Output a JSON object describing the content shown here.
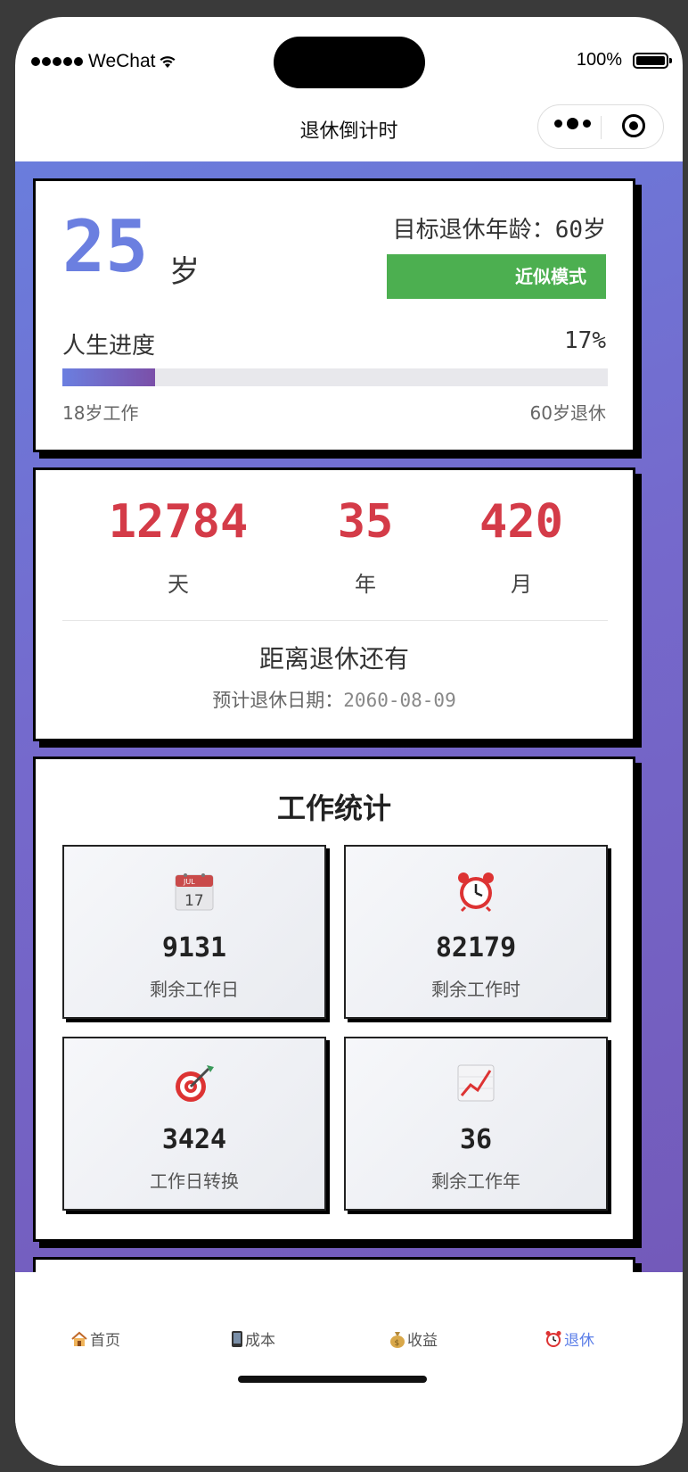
{
  "status_bar": {
    "carrier": "WeChat",
    "battery": "100%"
  },
  "nav": {
    "title": "退休倒计时"
  },
  "age_card": {
    "age": "25",
    "age_unit": "岁",
    "target_label": "目标退休年龄：",
    "target_value": "60岁",
    "mode_button": "近似模式",
    "progress_label": "人生进度",
    "progress_text": "17%",
    "progress_fraction": 0.17,
    "start_label": "18岁工作",
    "end_label": "60岁退休"
  },
  "countdown": {
    "days": "12784",
    "days_unit": "天",
    "years": "35",
    "years_unit": "年",
    "months": "420",
    "months_unit": "月",
    "title": "距离退休还有",
    "date_label": "预计退休日期：",
    "date_value": "2060-08-09"
  },
  "work_stats": {
    "title": "工作统计",
    "items": [
      {
        "icon": "calendar-icon",
        "value": "9131",
        "label": "剩余工作日"
      },
      {
        "icon": "alarm-clock-icon",
        "value": "82179",
        "label": "剩余工作时"
      },
      {
        "icon": "target-icon",
        "value": "3424",
        "label": "工作日转换"
      },
      {
        "icon": "chart-increasing-icon",
        "value": "36",
        "label": "剩余工作年"
      }
    ]
  },
  "tabbar": {
    "tabs": [
      {
        "icon": "house-icon",
        "label": "首页"
      },
      {
        "icon": "phone-icon",
        "label": "成本"
      },
      {
        "icon": "money-bag-icon",
        "label": "收益"
      },
      {
        "icon": "alarm-clock-icon",
        "label": "退休"
      }
    ],
    "active_index": 3
  },
  "colors": {
    "accent": "#6b7fe0",
    "countdown": "#d43b48",
    "mode_button": "#4caf50",
    "active_tab": "#5b7ee8"
  }
}
